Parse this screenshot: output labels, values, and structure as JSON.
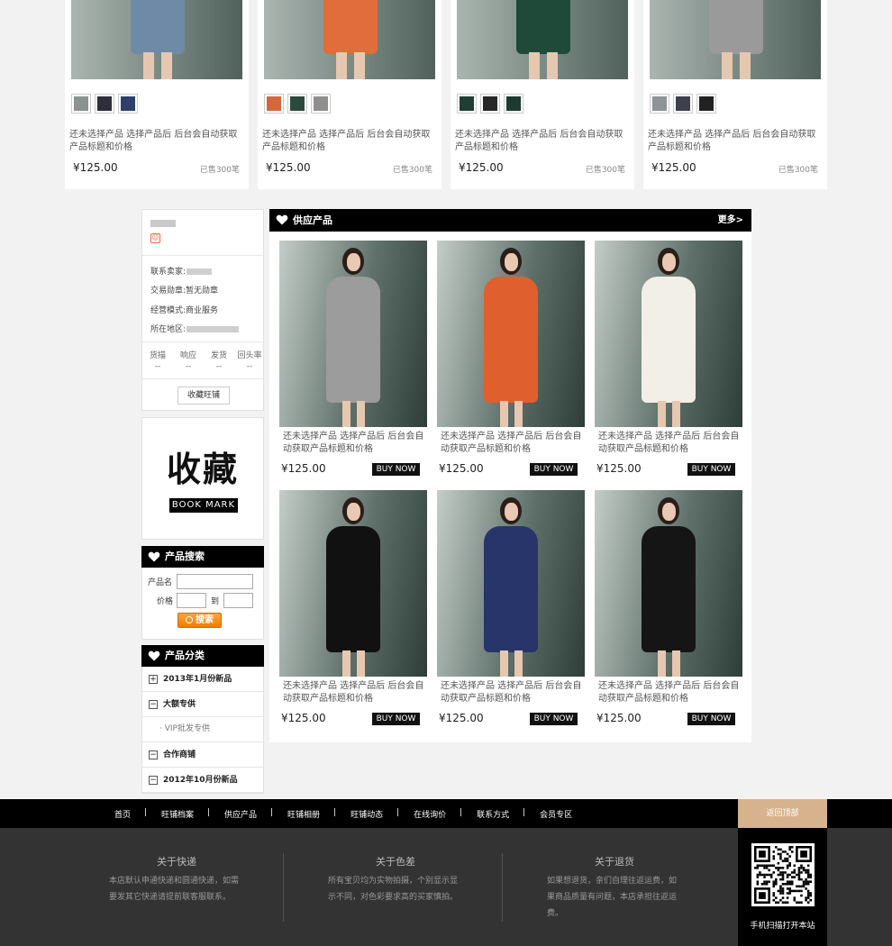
{
  "top_products": [
    {
      "title": "还未选择产品  选择产品后  后台会自动获取产品标题和价格",
      "price": "¥125.00",
      "sold": "已售300笔",
      "skirt_color": "#6f8aa6",
      "thumbs": [
        "#8a9390",
        "#2d2f3a",
        "#2f3f6a"
      ]
    },
    {
      "title": "还未选择产品  选择产品后  后台会自动获取产品标题和价格",
      "price": "¥125.00",
      "sold": "已售300笔",
      "skirt_color": "#e06d3b",
      "thumbs": [
        "#d4683a",
        "#2a4a3e",
        "#8f908e"
      ]
    },
    {
      "title": "还未选择产品  选择产品后  后台会自动获取产品标题和价格",
      "price": "¥125.00",
      "sold": "已售300笔",
      "skirt_color": "#1f4a3a",
      "thumbs": [
        "#1f3f35",
        "#282828",
        "#1c3a30"
      ]
    },
    {
      "title": "还未选择产品  选择产品后  后台会自动获取产品标题和价格",
      "price": "¥125.00",
      "sold": "已售300笔",
      "skirt_color": "#9a9a9a",
      "thumbs": [
        "#8c9498",
        "#3e4050",
        "#222222"
      ]
    }
  ],
  "shop": {
    "contact_label": "联系卖家:",
    "medal_label": "交易勋章:",
    "medal_value": "暂无勋章",
    "mode_label": "经营模式:",
    "mode_value": "商业服务",
    "location_label": "所在地区:",
    "stats": [
      {
        "label": "货描",
        "value": "--"
      },
      {
        "label": "响应",
        "value": "--"
      },
      {
        "label": "发货",
        "value": "--"
      },
      {
        "label": "回头率",
        "value": "--"
      }
    ],
    "favorite_button": "收藏旺铺"
  },
  "bookmark": {
    "title": "收藏",
    "tag": "BOOK MARK"
  },
  "search": {
    "heading": "产品搜索",
    "name_label": "产品名",
    "price_label": "价格",
    "to_label": "到",
    "button": "搜索"
  },
  "categories": {
    "heading": "产品分类",
    "items": [
      {
        "label": "2013年1月份新品",
        "toggle": "+",
        "type": "main"
      },
      {
        "label": "大额专供",
        "toggle": "−",
        "type": "main"
      },
      {
        "label": "·  VIP批发专供",
        "type": "sub"
      },
      {
        "label": "合作商铺",
        "toggle": "−",
        "type": "main"
      },
      {
        "label": "2012年10月份新品",
        "toggle": "−",
        "type": "main"
      }
    ]
  },
  "supply": {
    "heading": "供应产品",
    "more": "更多>",
    "products": [
      {
        "title": "还未选择产品  选择产品后  后台会自动获取产品标题和价格",
        "price": "¥125.00",
        "buy": "BUY NOW",
        "dress_color": "#9c9c9c"
      },
      {
        "title": "还未选择产品  选择产品后  后台会自动获取产品标题和价格",
        "price": "¥125.00",
        "buy": "BUY NOW",
        "dress_color": "#e05f2e"
      },
      {
        "title": "还未选择产品  选择产品后  后台会自动获取产品标题和价格",
        "price": "¥125.00",
        "buy": "BUY NOW",
        "dress_color": "#f2efe8"
      },
      {
        "title": "还未选择产品  选择产品后  后台会自动获取产品标题和价格",
        "price": "¥125.00",
        "buy": "BUY NOW",
        "dress_color": "#111111"
      },
      {
        "title": "还未选择产品  选择产品后  后台会自动获取产品标题和价格",
        "price": "¥125.00",
        "buy": "BUY NOW",
        "dress_color": "#27356b"
      },
      {
        "title": "还未选择产品  选择产品后  后台会自动获取产品标题和价格",
        "price": "¥125.00",
        "buy": "BUY NOW",
        "dress_color": "#151515"
      }
    ]
  },
  "nav": [
    "首页",
    "旺铺档案",
    "供应产品",
    "旺铺相册",
    "旺铺动态",
    "在线询价",
    "联系方式",
    "会员专区"
  ],
  "back_to_top": "返回顶部",
  "footer": [
    {
      "title": "关于快递",
      "text": "本店默认申通快递和圆通快递，如需要发其它快递请提前联客服联系。"
    },
    {
      "title": "关于色差",
      "text": "所有宝贝均为实物拍摄，个别显示显示不同，对色彩要求高的买家慎拍。"
    },
    {
      "title": "关于退货",
      "text": "如果想退货，亲们自理往返运费，如果商品质量有问题，本店承担往返运费。"
    }
  ],
  "qr_caption": "手机扫描打开本站",
  "colors": {
    "accent_orange": "#f07c00",
    "back_top_bg": "#d6b28d",
    "header_black": "#000000"
  }
}
